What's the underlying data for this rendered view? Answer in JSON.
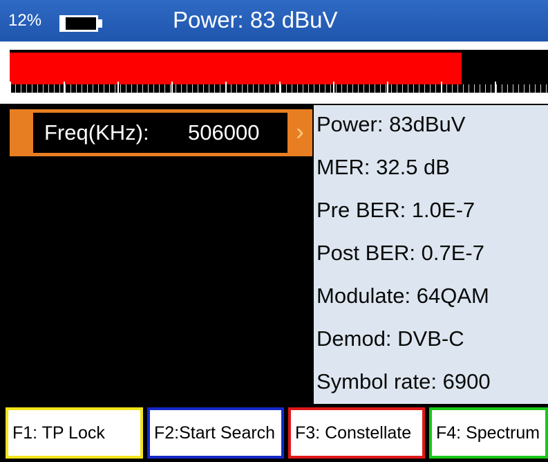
{
  "status": {
    "battery_percent": "12%",
    "battery_level": 0.12,
    "title": "Power: 83 dBuV"
  },
  "meter": {
    "level_fraction": 0.84,
    "bar_color": "#ff0000"
  },
  "frequency": {
    "label": "Freq(KHz):",
    "value": "506000"
  },
  "info": [
    "Power: 83dBuV",
    "MER: 32.5 dB",
    "Pre BER: 1.0E-7",
    "Post BER: 0.7E-7",
    "Modulate: 64QAM",
    "Demod: DVB-C",
    "Symbol rate: 6900"
  ],
  "function_keys": [
    {
      "label": "F1:   TP Lock",
      "color": "#f3e41a"
    },
    {
      "label": "F2:Start Search",
      "color": "#1428c8"
    },
    {
      "label": "F3: Constellate",
      "color": "#e01818"
    },
    {
      "label": "F4:  Spectrum",
      "color": "#18c818"
    }
  ],
  "colors": {
    "header": "#2560b8",
    "selected_row": "#e87e22",
    "info_panel": "#dde6f0"
  }
}
